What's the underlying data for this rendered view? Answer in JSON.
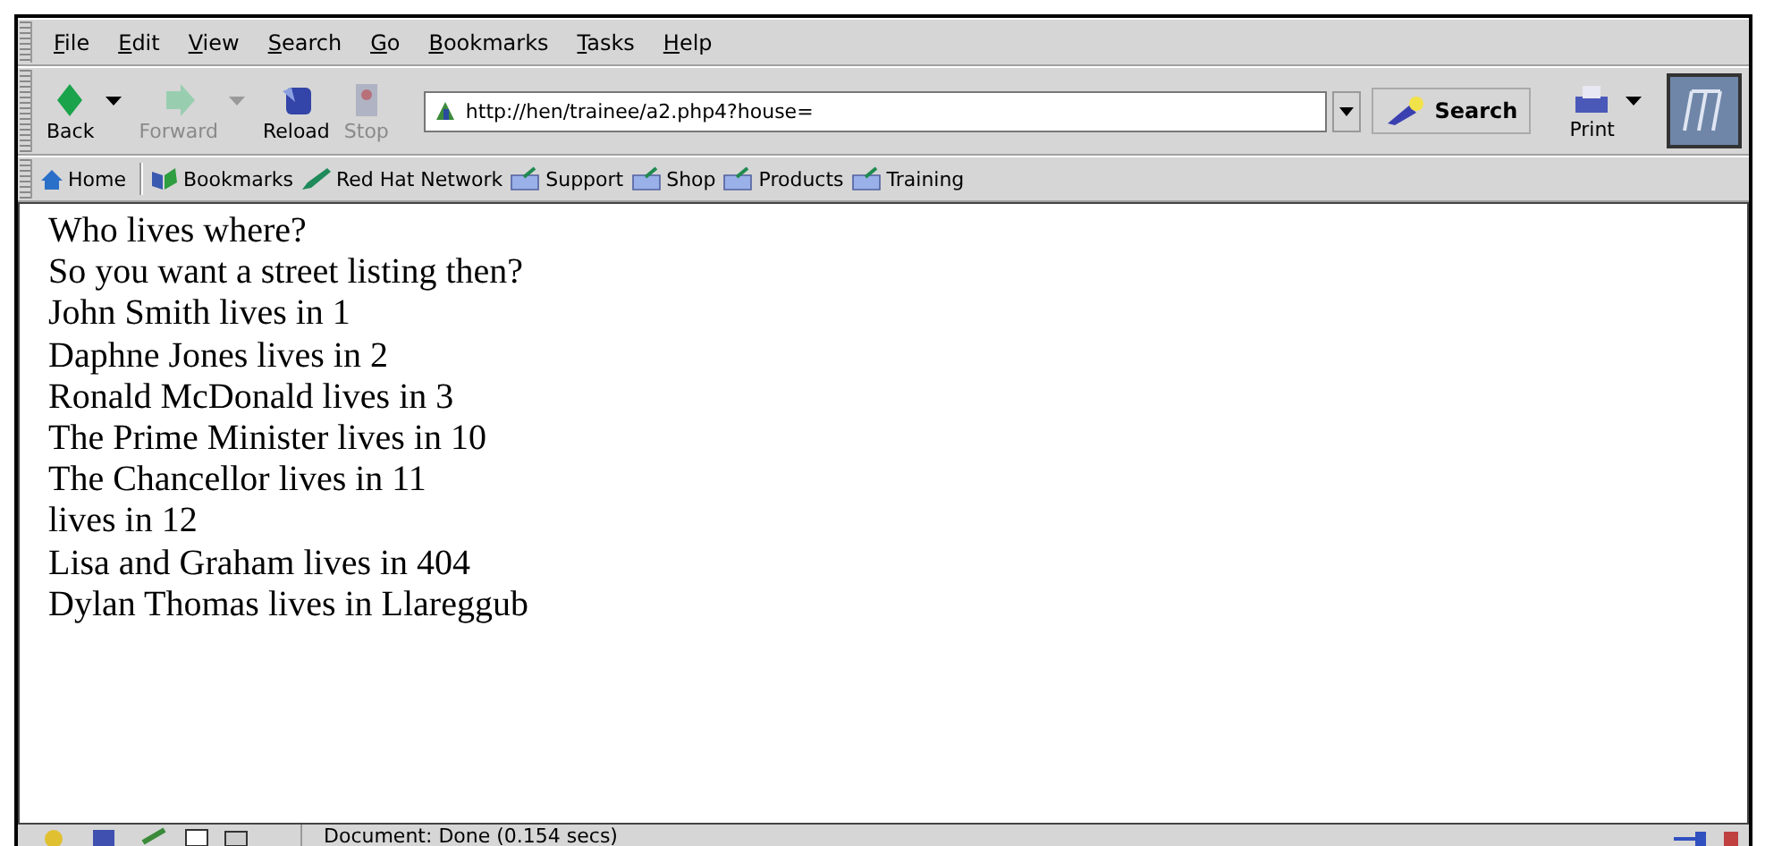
{
  "menu": [
    "File",
    "Edit",
    "View",
    "Search",
    "Go",
    "Bookmarks",
    "Tasks",
    "Help"
  ],
  "toolbar": [
    {
      "label": "Back",
      "kind": "back",
      "disabled": false,
      "dropdown": true
    },
    {
      "label": "Forward",
      "kind": "forward",
      "disabled": true,
      "dropdown": true
    },
    {
      "label": "Reload",
      "kind": "reload",
      "disabled": false,
      "dropdown": false
    },
    {
      "label": "Stop",
      "kind": "stop",
      "disabled": true,
      "dropdown": false
    }
  ],
  "address": {
    "value": "http://hen/trainee/a2.php4?house="
  },
  "search_button": "Search",
  "print_button": "Print",
  "bookmarks": [
    {
      "label": "Home",
      "kind": "home"
    },
    {
      "label": "Bookmarks",
      "kind": "bookmarks"
    },
    {
      "label": "Red Hat Network",
      "kind": "pen"
    },
    {
      "label": "Support",
      "kind": "folder"
    },
    {
      "label": "Shop",
      "kind": "folder"
    },
    {
      "label": "Products",
      "kind": "folder"
    },
    {
      "label": "Training",
      "kind": "folder"
    }
  ],
  "content": [
    "Who lives where?",
    "So you want a street listing then?",
    "John Smith lives in 1",
    "Daphne Jones lives in 2",
    "Ronald McDonald lives in 3",
    "The Prime Minister lives in 10",
    "The Chancellor lives in 11",
    "lives in 12",
    "Lisa and Graham lives in 404",
    "Dylan Thomas lives in Llareggub"
  ],
  "status": "Document: Done (0.154 secs)"
}
